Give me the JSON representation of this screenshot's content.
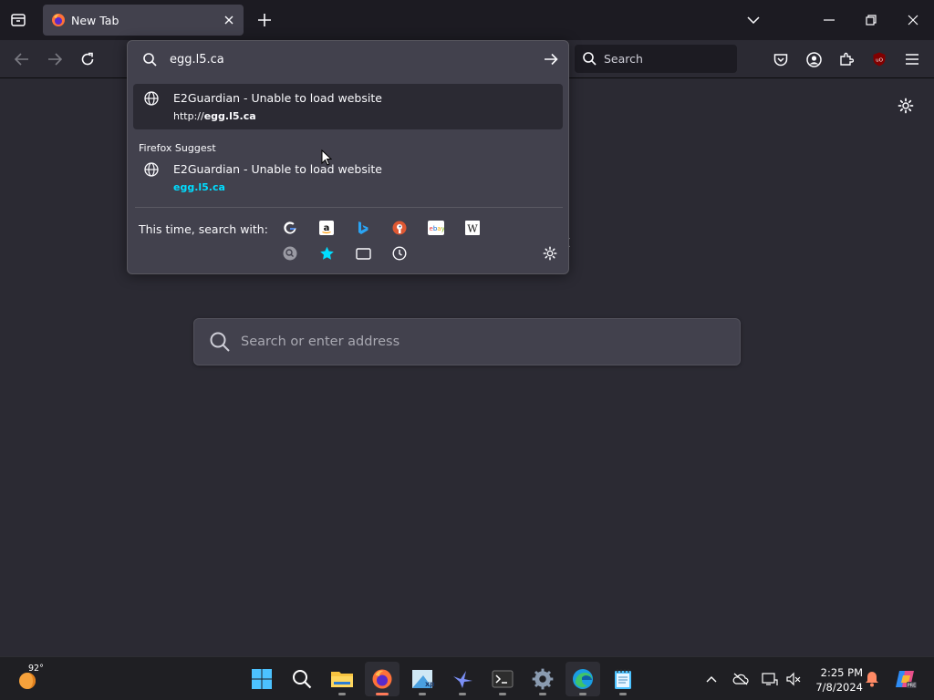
{
  "browser": {
    "tab": {
      "title": "New Tab"
    },
    "search_bar": {
      "placeholder": "Search"
    },
    "urlbar": {
      "value": "egg.l5.ca",
      "results": [
        {
          "title": "E2Guardian - Unable to load website",
          "url_prefix": "http://",
          "url_host": "egg.l5.ca",
          "selected": true
        },
        {
          "title": "E2Guardian - Unable to load website",
          "url_prefix": "",
          "url_host": "egg.l5.ca",
          "selected": false
        }
      ],
      "group_label": "Firefox Suggest",
      "one_off_label": "This time, search with:",
      "engines": [
        "google-icon",
        "amazon-icon",
        "bing-icon",
        "duckduckgo-icon",
        "ebay-icon",
        "wikipedia-icon",
        "search-engine-icon",
        "bookmarks-icon",
        "tabs-icon",
        "history-icon"
      ]
    },
    "content": {
      "search_placeholder": "Search or enter address"
    }
  },
  "taskbar": {
    "weather_temp": "92°",
    "time": "2:25 PM",
    "date": "7/8/2024",
    "apps": [
      "windows-start-icon",
      "search-icon",
      "file-explorer-icon",
      "firefox-icon",
      "xp-app-icon",
      "bird-app-icon",
      "terminal-icon",
      "settings-icon",
      "edge-icon",
      "notepad-icon"
    ]
  },
  "colors": {
    "chrome_bg": "#1c1b22",
    "toolbar_bg": "#2b2a33",
    "popup_bg": "#42414d",
    "accent_link": "#00ddff"
  }
}
